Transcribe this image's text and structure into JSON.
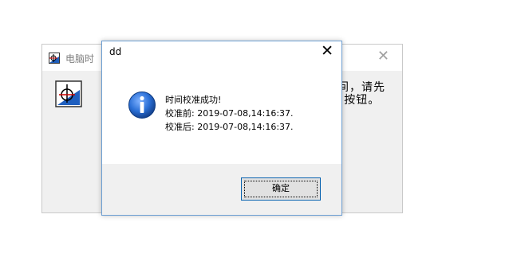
{
  "background_window": {
    "title": "电脑时",
    "close_glyph": "✕",
    "body_text_line1": "间，请先",
    "body_text_line2": "”按钮。"
  },
  "dialog": {
    "title": "dd",
    "close_glyph": "✕",
    "message": [
      "时间校准成功!",
      "校准前: 2019-07-08,14:16:37.",
      "校准后: 2019-07-08,14:16:37."
    ],
    "ok_label": "确定"
  },
  "colors": {
    "info_blue": "#1f5fbf",
    "dialog_border": "#6d9fd3",
    "button_border": "#0a64b0"
  }
}
